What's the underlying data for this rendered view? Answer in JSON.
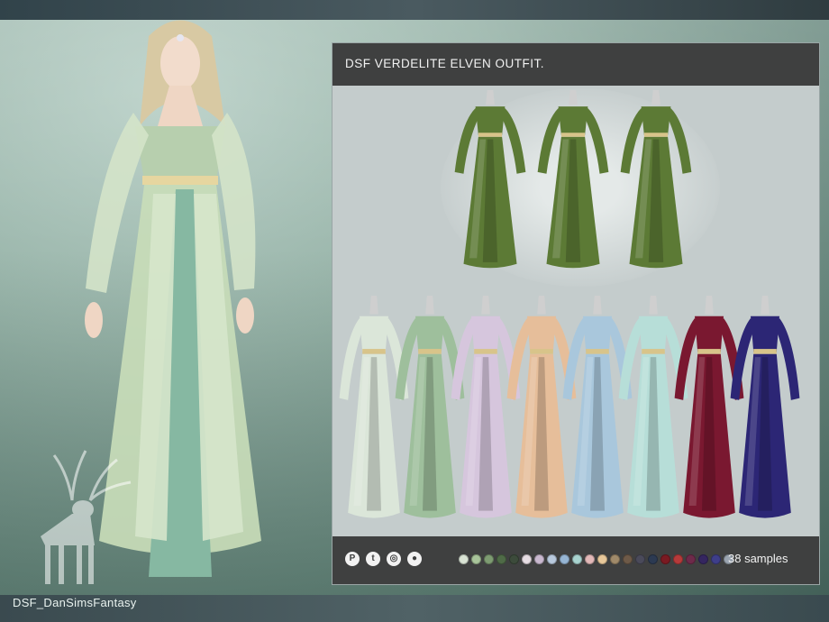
{
  "title": "DSF  VERDELITE ELVEN OUTFIT.",
  "watermark": "DSF_DanSimsFantasy",
  "samples_text": "38 samples",
  "social_icons": [
    "pinterest-icon",
    "tumblr-icon",
    "instagram-icon",
    "patreon-icon"
  ],
  "swatch_colors": [
    "#d9e3d4",
    "#a8c49a",
    "#7e9c72",
    "#4f6b47",
    "#3c4b3b",
    "#e6dde3",
    "#c9b8cf",
    "#b8c9dd",
    "#96b5d4",
    "#a8d3cf",
    "#e2b8b8",
    "#e8c89a",
    "#a08a6a",
    "#6e5a48",
    "#4a4a5a",
    "#2c3a52",
    "#7a1a22",
    "#b63a3a",
    "#6e2a4a",
    "#352660",
    "#3e3e8a",
    "#9aa4b0"
  ],
  "preview_outfits": [
    {
      "name": "preview-outfit-front",
      "color": "#5c7a35"
    },
    {
      "name": "preview-outfit-open",
      "color": "#5c7a35"
    },
    {
      "name": "preview-outfit-back",
      "color": "#5c7a35"
    }
  ],
  "color_variants": [
    {
      "name": "sage-white",
      "color": "#dbe6d9"
    },
    {
      "name": "sage-green",
      "color": "#9ebf9c"
    },
    {
      "name": "lavender",
      "color": "#d6c6dd"
    },
    {
      "name": "peach",
      "color": "#e6be9a"
    },
    {
      "name": "light-blue",
      "color": "#a9c7dc"
    },
    {
      "name": "aqua",
      "color": "#b7ded8"
    },
    {
      "name": "burgundy",
      "color": "#7a1830"
    },
    {
      "name": "indigo",
      "color": "#2c2675"
    }
  ]
}
